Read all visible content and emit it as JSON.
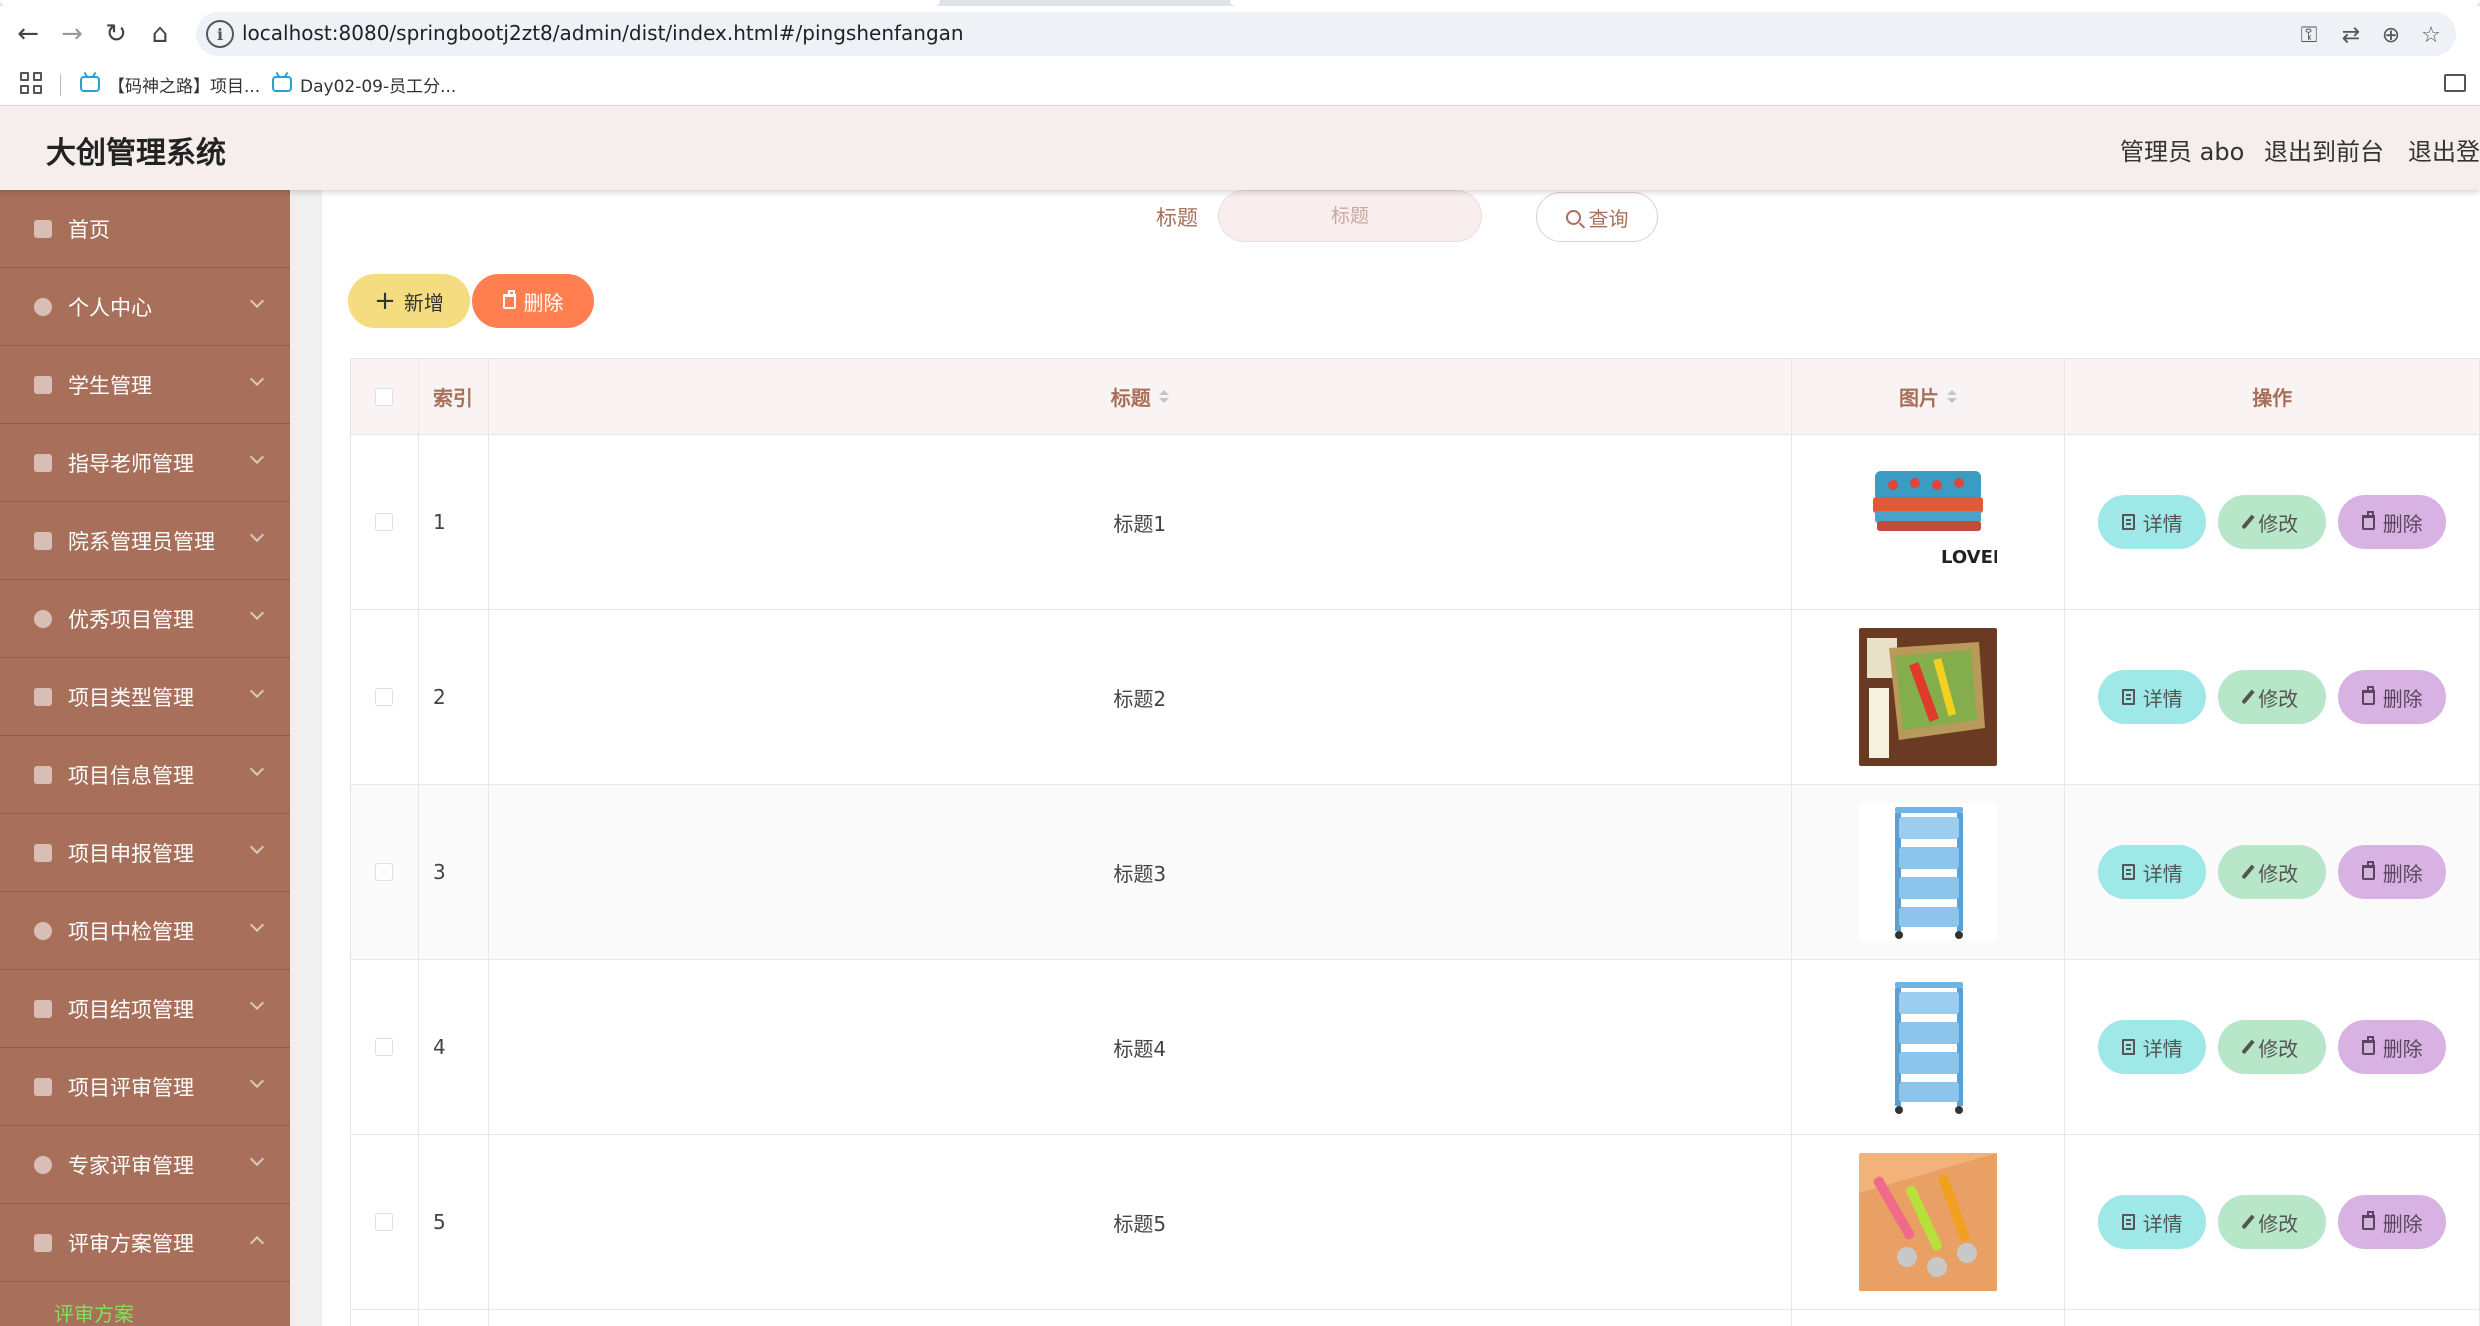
{
  "browser": {
    "url": "localhost:8080/springbootj2zt8/admin/dist/index.html#/pingshenfangan",
    "bookmarks": [
      {
        "label": "【码神之路】项目..."
      },
      {
        "label": "Day02-09-员工分..."
      }
    ]
  },
  "header": {
    "title": "大创管理系统",
    "user_label": "管理员 abo",
    "front_link": "退出到前台",
    "logout_link": "退出登录"
  },
  "sidebar": {
    "items": [
      {
        "label": "首页",
        "icon": "home-icon"
      },
      {
        "label": "个人中心",
        "icon": "user-icon"
      },
      {
        "label": "学生管理",
        "icon": "student-icon"
      },
      {
        "label": "指导老师管理",
        "icon": "mail-icon"
      },
      {
        "label": "院系管理员管理",
        "icon": "briefcase-icon"
      },
      {
        "label": "优秀项目管理",
        "icon": "star-user-icon"
      },
      {
        "label": "项目类型管理",
        "icon": "grid-icon"
      },
      {
        "label": "项目信息管理",
        "icon": "info-icon"
      },
      {
        "label": "项目申报管理",
        "icon": "flag-icon"
      },
      {
        "label": "项目中检管理",
        "icon": "power-icon"
      },
      {
        "label": "项目结项管理",
        "icon": "chart-icon"
      },
      {
        "label": "项目评审管理",
        "icon": "send-icon"
      },
      {
        "label": "专家评审管理",
        "icon": "pen-icon"
      },
      {
        "label": "评审方案管理",
        "icon": "scheme-icon"
      }
    ],
    "sub_item": "评审方案"
  },
  "search": {
    "label": "标题",
    "placeholder": "标题",
    "query_label": "查询"
  },
  "toolbar": {
    "add_label": "新增",
    "delete_label": "删除"
  },
  "table": {
    "headers": {
      "index": "索引",
      "title": "标题",
      "image": "图片",
      "ops": "操作"
    },
    "rows": [
      {
        "index": "1",
        "title": "标题1",
        "image": "towel-product"
      },
      {
        "index": "2",
        "title": "标题2",
        "image": "kitchen-tools-product"
      },
      {
        "index": "3",
        "title": "标题3",
        "image": "blue-shelf-product"
      },
      {
        "index": "4",
        "title": "标题4",
        "image": "blue-shelf-product"
      },
      {
        "index": "5",
        "title": "标题5",
        "image": "peeler-product"
      }
    ],
    "actions": {
      "detail": "详情",
      "edit": "修改",
      "delete": "删除"
    }
  },
  "colors": {
    "sidebar_bg": "#a8705a",
    "header_bg": "#f5eeec",
    "add_btn": "#f5dc80",
    "delete_btn": "#ff7f50",
    "detail_btn": "#9fe8e8",
    "edit_btn": "#b8e6c8",
    "row_delete_btn": "#d8b2e2",
    "active_submenu": "#7ee35a"
  }
}
